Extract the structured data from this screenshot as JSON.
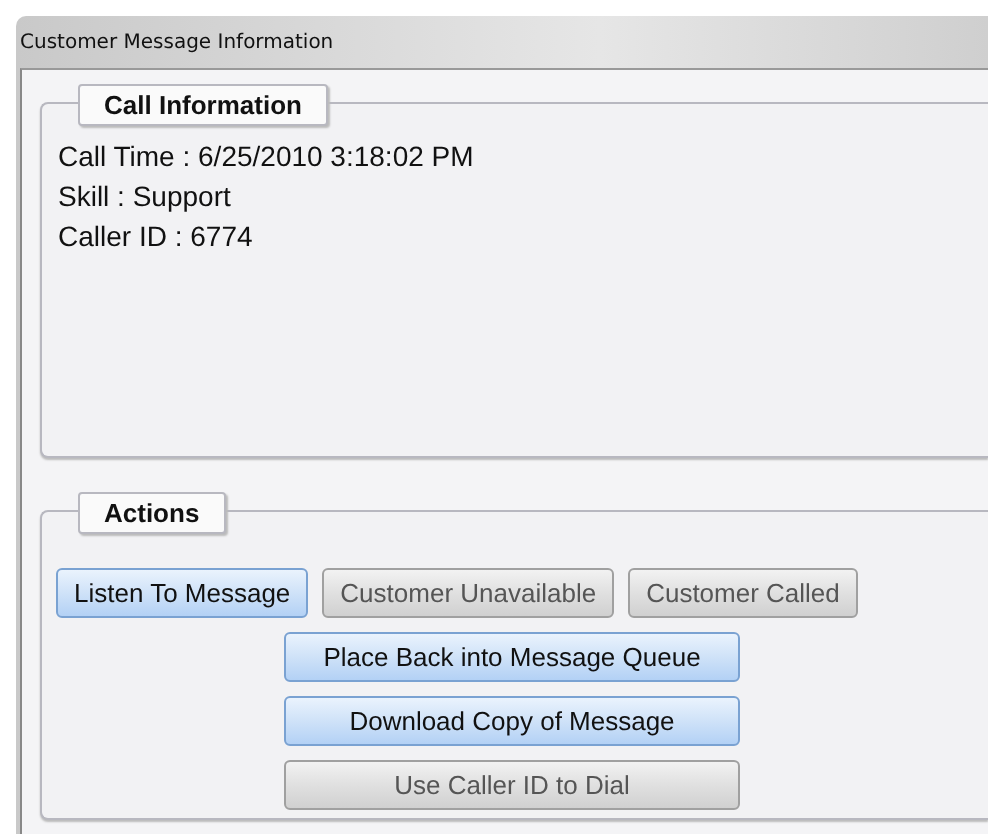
{
  "window": {
    "title": "Customer Message Information"
  },
  "call_information": {
    "title": "Call Information",
    "lines": [
      "Call Time : 6/25/2010 3:18:02 PM",
      "Skill : Support",
      "Caller ID : 6774"
    ]
  },
  "actions": {
    "title": "Actions",
    "rows": [
      [
        {
          "label": "Listen To Message",
          "disabled": false
        },
        {
          "label": "Customer Unavailable",
          "disabled": true
        },
        {
          "label": "Customer Called",
          "disabled": true
        }
      ],
      [
        {
          "label": "Place Back into Message Queue",
          "disabled": false
        }
      ],
      [
        {
          "label": "Download Copy of Message",
          "disabled": false
        }
      ],
      [
        {
          "label": "Use Caller ID to Dial",
          "disabled": true
        }
      ]
    ]
  }
}
